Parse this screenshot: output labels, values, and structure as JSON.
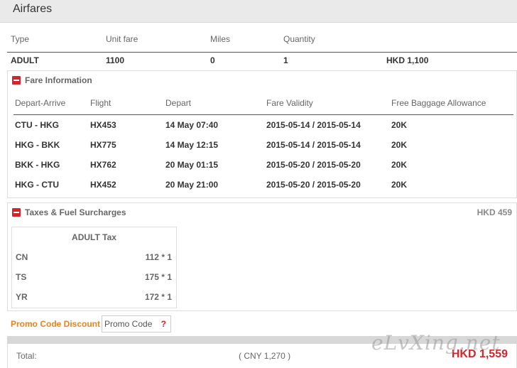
{
  "header": {
    "title": "Airfares"
  },
  "summary": {
    "columns": [
      "Type",
      "Unit fare",
      "Miles",
      "Quantity"
    ],
    "row": {
      "type": "ADULT",
      "unit_fare": "1100",
      "miles": "0",
      "quantity": "1",
      "amount": "HKD 1,100"
    }
  },
  "fare_info": {
    "title": "Fare Information",
    "columns": [
      "Depart-Arrive",
      "Flight",
      "Depart",
      "Fare Validity",
      "Free Baggage Allowance"
    ],
    "rows": [
      {
        "route": "CTU - HKG",
        "flight": "HX453",
        "depart": "14 May 07:40",
        "validity": "2015-05-14 / 2015-05-14",
        "baggage": "20K"
      },
      {
        "route": "HKG - BKK",
        "flight": "HX775",
        "depart": "14 May 12:15",
        "validity": "2015-05-14 / 2015-05-14",
        "baggage": "20K"
      },
      {
        "route": "BKK - HKG",
        "flight": "HX762",
        "depart": "20 May 01:15",
        "validity": "2015-05-20 / 2015-05-20",
        "baggage": "20K"
      },
      {
        "route": "HKG - CTU",
        "flight": "HX452",
        "depart": "20 May 21:00",
        "validity": "2015-05-20 / 2015-05-20",
        "baggage": "20K"
      }
    ]
  },
  "taxes": {
    "title": "Taxes & Fuel Surcharges",
    "total": "HKD 459",
    "table_title": "ADULT Tax",
    "rows": [
      {
        "code": "CN",
        "amount": "112 * 1"
      },
      {
        "code": "TS",
        "amount": "175 * 1"
      },
      {
        "code": "YR",
        "amount": "172 * 1"
      }
    ]
  },
  "promo": {
    "label": "Promo Code Discount",
    "placeholder": "Promo Code",
    "help": "?"
  },
  "total": {
    "label": "Total:",
    "cny": "( CNY 1,270 )",
    "amount": "HKD 1,559"
  },
  "watermark": "eLvXing.net",
  "colors": {
    "accent_red": "#d4252b",
    "promo_orange": "#e8821e",
    "header_gray": "#eaeaea"
  },
  "icons": {
    "section_toggle": "minus-icon",
    "help": "help-icon"
  }
}
